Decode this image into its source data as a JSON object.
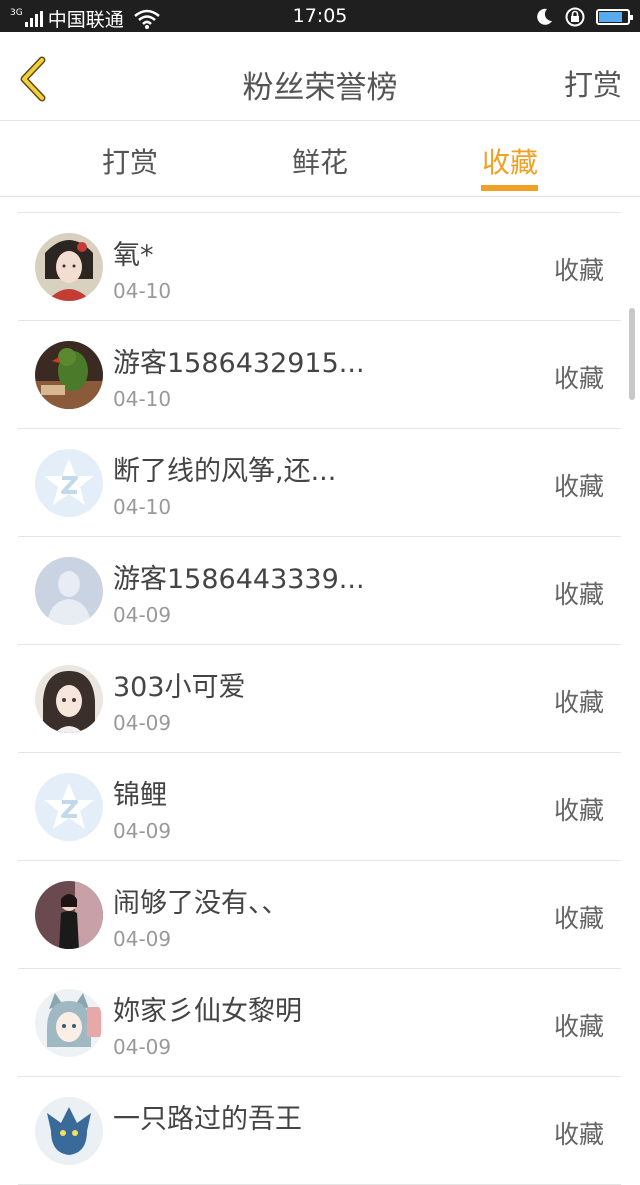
{
  "status_bar": {
    "network": "3G",
    "carrier": "中国联通",
    "time": "17:05",
    "icons": [
      "signal-icon",
      "wifi-icon",
      "moon-icon",
      "rotation-lock-icon",
      "battery-icon"
    ],
    "battery_level": 0.9
  },
  "nav": {
    "title": "粉丝荣誉榜",
    "action_label": "打赏",
    "back_icon": "chevron-left-icon"
  },
  "tabs": [
    {
      "label": "打赏",
      "active": false
    },
    {
      "label": "鲜花",
      "active": false
    },
    {
      "label": "收藏",
      "active": true
    }
  ],
  "colors": {
    "accent": "#f0a024",
    "text": "#444444",
    "muted": "#999999",
    "divider": "#e5e5e5"
  },
  "fans": [
    {
      "name": "氧*",
      "date": "04-10",
      "action": "收藏",
      "avatar": "illustrated-girl-avatar"
    },
    {
      "name": "游客1586432915...",
      "date": "04-10",
      "action": "收藏",
      "avatar": "parrot-photo-avatar"
    },
    {
      "name": "断了线的风筝,还...",
      "date": "04-10",
      "action": "收藏",
      "avatar": "default-qq-star-avatar"
    },
    {
      "name": "游客1586443339...",
      "date": "04-09",
      "action": "收藏",
      "avatar": "default-person-avatar"
    },
    {
      "name": "303小可爱",
      "date": "04-09",
      "action": "收藏",
      "avatar": "anime-girl-avatar"
    },
    {
      "name": "锦鲤",
      "date": "04-09",
      "action": "收藏",
      "avatar": "default-qq-star-avatar"
    },
    {
      "name": "闹够了没有、、",
      "date": "04-09",
      "action": "收藏",
      "avatar": "woman-photo-avatar"
    },
    {
      "name": "妳家彡仙女黎明",
      "date": "04-09",
      "action": "收藏",
      "avatar": "anime-catgirl-avatar"
    },
    {
      "name": "一只路过的吾王",
      "date": "",
      "action": "收藏",
      "avatar": "blue-dragon-avatar"
    }
  ]
}
